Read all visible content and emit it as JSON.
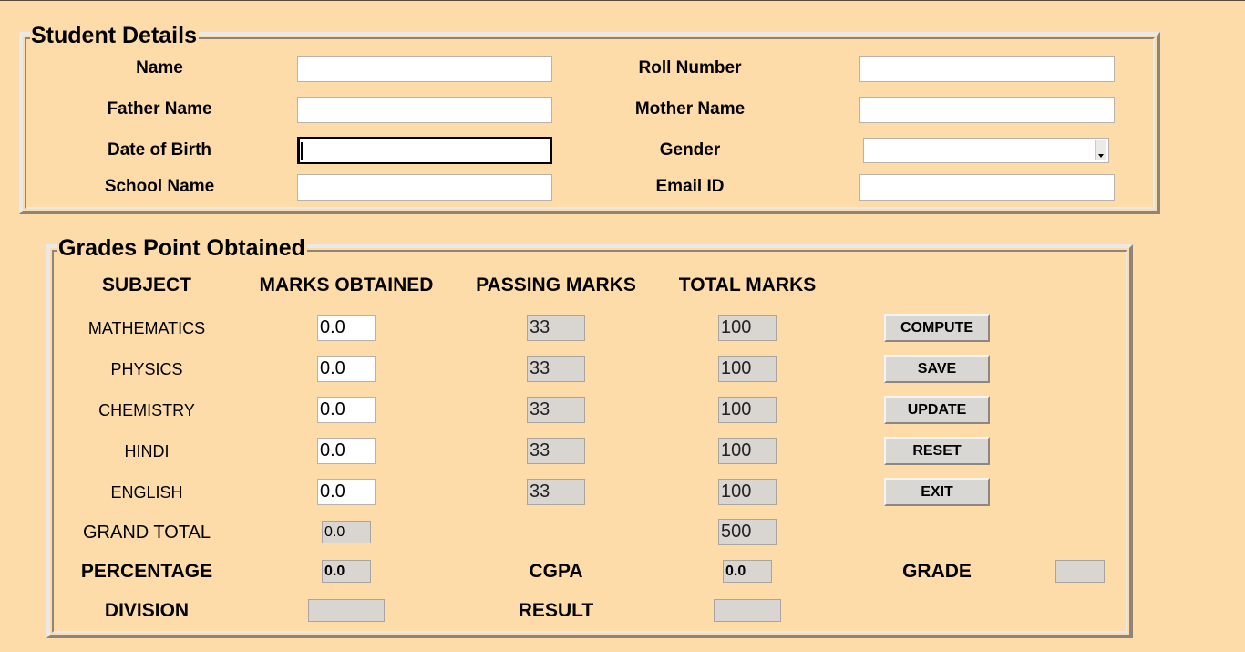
{
  "student_details": {
    "title": "Student Details",
    "labels": {
      "name": "Name",
      "roll_number": "Roll Number",
      "father_name": "Father Name",
      "mother_name": "Mother Name",
      "date_of_birth": "Date of Birth",
      "gender": "Gender",
      "school_name": "School Name",
      "email_id": "Email ID"
    },
    "values": {
      "name": "",
      "roll_number": "",
      "father_name": "",
      "mother_name": "",
      "date_of_birth": "",
      "gender": "",
      "school_name": "",
      "email_id": ""
    }
  },
  "grades": {
    "title": "Grades Point Obtained",
    "headers": {
      "subject": "SUBJECT",
      "marks_obtained": "MARKS OBTAINED",
      "passing_marks": "PASSING MARKS",
      "total_marks": "TOTAL MARKS"
    },
    "subjects": [
      {
        "name": "MATHEMATICS",
        "obtained": "0.0",
        "passing": "33",
        "total": "100"
      },
      {
        "name": "PHYSICS",
        "obtained": "0.0",
        "passing": "33",
        "total": "100"
      },
      {
        "name": "CHEMISTRY",
        "obtained": "0.0",
        "passing": "33",
        "total": "100"
      },
      {
        "name": "HINDI",
        "obtained": "0.0",
        "passing": "33",
        "total": "100"
      },
      {
        "name": "ENGLISH",
        "obtained": "0.0",
        "passing": "33",
        "total": "100"
      }
    ],
    "buttons": {
      "compute": "COMPUTE",
      "save": "SAVE",
      "update": "UPDATE",
      "reset": "RESET",
      "exit": "EXIT"
    },
    "grand_total": {
      "label": "GRAND TOTAL",
      "obtained": "0.0",
      "total": "500"
    },
    "percentage": {
      "label": "PERCENTAGE",
      "value": "0.0"
    },
    "cgpa": {
      "label": "CGPA",
      "value": "0.0"
    },
    "grade": {
      "label": "GRADE",
      "value": ""
    },
    "division": {
      "label": "DIVISION",
      "value": ""
    },
    "result": {
      "label": "RESULT",
      "value": ""
    }
  },
  "colors": {
    "background": "#fddcaa",
    "readonly_field": "#d9d6d2",
    "button": "#d9d7d4"
  }
}
